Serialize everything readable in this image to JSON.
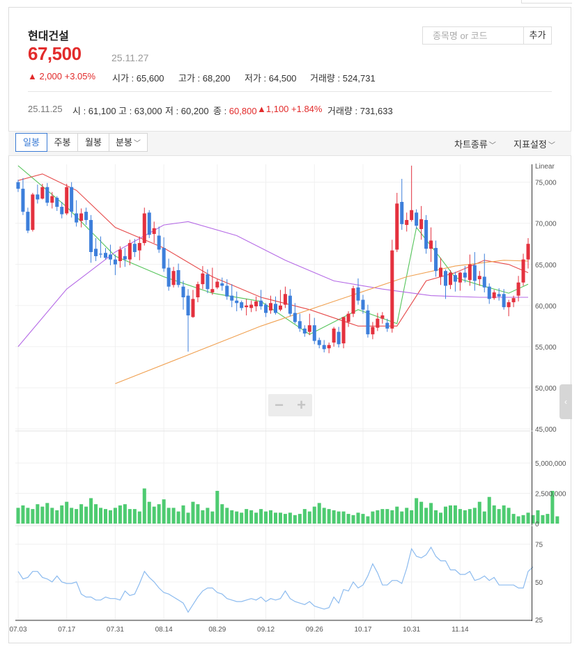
{
  "stock": {
    "name": "현대건설",
    "price": "67,500",
    "date": "25.11.27",
    "change": "▲ 2,000 +3.05%",
    "stats": [
      {
        "label": "시가 : ",
        "value": "65,600"
      },
      {
        "label": "고가 : ",
        "value": "68,200"
      },
      {
        "label": "저가 : ",
        "value": "64,500"
      },
      {
        "label": "거래량 : ",
        "value": "524,731"
      }
    ]
  },
  "search": {
    "placeholder": "종목명 or 코드",
    "add_label": "추가"
  },
  "prev": {
    "date": "25.11.25",
    "open": "시 : 61,100",
    "high": "고 : 63,000",
    "low": "저 : 60,200",
    "close_label": "종 : ",
    "close_value": "60,800",
    "change": "▲1,100 +1.84%",
    "volume": "거래량 : 731,633"
  },
  "periods": [
    "일봉",
    "주봉",
    "월봉",
    "분봉"
  ],
  "chart_type_label": "차트종류",
  "indicator_label": "지표설정",
  "colors": {
    "up": "#e4313e",
    "down": "#3d7fdb",
    "volume": "#4ecb71",
    "ma5": "#55c45a",
    "ma20": "#e64a4a",
    "ma60": "#b56ae6",
    "ma120": "#f0a050",
    "rsi": "#8cbbef"
  },
  "chart_data": [
    {
      "type": "candlestick",
      "scale_label": "Linear",
      "ylim": [
        45000,
        77000
      ],
      "yticks": [
        "75,000",
        "70,000",
        "65,000",
        "60,000",
        "55,000",
        "50,000",
        "45,000"
      ],
      "ytick_values": [
        75000,
        70000,
        65000,
        60000,
        55000,
        50000,
        45000
      ],
      "x_ticks": [
        "07.03",
        "07.17",
        "07.31",
        "08.14",
        "08.29",
        "09.12",
        "09.26",
        "10.17",
        "10.31",
        "11.14"
      ],
      "x_tick_index": [
        0,
        10,
        20,
        30,
        41,
        51,
        61,
        71,
        81,
        91
      ],
      "candles": [
        [
          75000,
          75300,
          73800,
          74200
        ],
        [
          74200,
          75500,
          71000,
          71400
        ],
        [
          71400,
          71900,
          68800,
          69100
        ],
        [
          69200,
          73700,
          69000,
          73500
        ],
        [
          73500,
          74700,
          72400,
          72900
        ],
        [
          73000,
          74800,
          72900,
          74400
        ],
        [
          74400,
          74900,
          72100,
          72500
        ],
        [
          72500,
          73800,
          71800,
          73300
        ],
        [
          73100,
          73300,
          71500,
          72000
        ],
        [
          72000,
          72600,
          70600,
          71100
        ],
        [
          71200,
          74800,
          71000,
          74400
        ],
        [
          74400,
          75000,
          70700,
          71400
        ],
        [
          71200,
          72800,
          69600,
          70100
        ],
        [
          70300,
          71800,
          69500,
          71200
        ],
        [
          71400,
          71900,
          69800,
          70400
        ],
        [
          70400,
          71000,
          65200,
          66500
        ],
        [
          66900,
          68200,
          65400,
          66000
        ],
        [
          66300,
          68400,
          65800,
          66200
        ],
        [
          66400,
          67000,
          65600,
          65800
        ],
        [
          66200,
          67400,
          64900,
          65600
        ],
        [
          65600,
          66200,
          63700,
          65000
        ],
        [
          65400,
          67200,
          64600,
          66800
        ],
        [
          66000,
          67000,
          64700,
          65600
        ],
        [
          65600,
          68000,
          64900,
          67600
        ],
        [
          67500,
          68100,
          65900,
          66500
        ],
        [
          66700,
          68400,
          65500,
          67600
        ],
        [
          67600,
          71900,
          67300,
          71200
        ],
        [
          71300,
          71600,
          68200,
          68600
        ],
        [
          68700,
          70200,
          67600,
          69400
        ],
        [
          68500,
          69600,
          66400,
          66800
        ],
        [
          67000,
          68300,
          64100,
          64500
        ],
        [
          64600,
          65700,
          61800,
          62300
        ],
        [
          62500,
          64700,
          62200,
          64200
        ],
        [
          64300,
          65100,
          62200,
          62500
        ],
        [
          62300,
          63000,
          59500,
          61000
        ],
        [
          61200,
          62000,
          54400,
          58800
        ],
        [
          58600,
          61900,
          58500,
          60800
        ],
        [
          61000,
          62900,
          60400,
          62600
        ],
        [
          62600,
          64800,
          62000,
          63900
        ],
        [
          63800,
          64400,
          61500,
          62000
        ],
        [
          61600,
          64600,
          61300,
          62000
        ],
        [
          62200,
          63200,
          62000,
          62900
        ],
        [
          62700,
          63400,
          61800,
          62400
        ],
        [
          62400,
          63200,
          60700,
          61100
        ],
        [
          61200,
          62600,
          59800,
          60600
        ],
        [
          60600,
          61700,
          59300,
          60300
        ],
        [
          60400,
          60600,
          59400,
          59700
        ],
        [
          59800,
          60800,
          58800,
          60000
        ],
        [
          59700,
          60600,
          59200,
          60100
        ],
        [
          59900,
          61100,
          59300,
          60500
        ],
        [
          60600,
          61900,
          59500,
          59900
        ],
        [
          60100,
          60300,
          58600,
          59100
        ],
        [
          59400,
          61200,
          59000,
          60300
        ],
        [
          60200,
          61100,
          58900,
          59100
        ],
        [
          59500,
          61900,
          59300,
          60000
        ],
        [
          60100,
          62300,
          59700,
          61400
        ],
        [
          61200,
          62000,
          58700,
          59000
        ],
        [
          59100,
          60300,
          57800,
          58000
        ],
        [
          58100,
          59000,
          56800,
          57200
        ],
        [
          57200,
          57600,
          56200,
          56600
        ],
        [
          56800,
          59000,
          56400,
          57600
        ],
        [
          57600,
          58500,
          55300,
          55700
        ],
        [
          55800,
          56100,
          54800,
          55200
        ],
        [
          55200,
          55800,
          54300,
          54700
        ],
        [
          54800,
          55500,
          54200,
          55200
        ],
        [
          55500,
          57400,
          55000,
          57200
        ],
        [
          56800,
          57400,
          54900,
          55300
        ],
        [
          55400,
          58000,
          54800,
          58600
        ],
        [
          58000,
          59300,
          57400,
          59000
        ],
        [
          59000,
          62400,
          58600,
          62100
        ],
        [
          62200,
          63300,
          60100,
          60600
        ],
        [
          60700,
          61300,
          59000,
          59500
        ],
        [
          59400,
          60100,
          56100,
          56500
        ],
        [
          56500,
          58000,
          55900,
          57400
        ],
        [
          57300,
          59100,
          56900,
          58400
        ],
        [
          58400,
          59200,
          57800,
          58800
        ],
        [
          57900,
          58400,
          56800,
          57200
        ],
        [
          57200,
          68000,
          56700,
          66700
        ],
        [
          66800,
          73700,
          66500,
          72400
        ],
        [
          72600,
          75400,
          69200,
          69900
        ],
        [
          69800,
          71300,
          69000,
          70400
        ],
        [
          70400,
          77000,
          70200,
          71600
        ],
        [
          71300,
          71700,
          69300,
          69700
        ],
        [
          69300,
          72100,
          68000,
          70500
        ],
        [
          70400,
          71000,
          66300,
          66900
        ],
        [
          66900,
          69500,
          65300,
          67900
        ],
        [
          67000,
          67900,
          63500,
          64200
        ],
        [
          63500,
          65800,
          62500,
          64600
        ],
        [
          64200,
          64400,
          60800,
          62400
        ],
        [
          62500,
          64300,
          62000,
          64000
        ],
        [
          63700,
          64100,
          61700,
          62900
        ],
        [
          62800,
          64100,
          61800,
          64000
        ],
        [
          64000,
          64800,
          62800,
          63400
        ],
        [
          63100,
          66200,
          62400,
          65000
        ],
        [
          64900,
          66500,
          61800,
          63000
        ],
        [
          63200,
          64200,
          62400,
          63600
        ],
        [
          63500,
          66300,
          61600,
          62200
        ],
        [
          62300,
          62700,
          60200,
          60800
        ],
        [
          60900,
          61900,
          60700,
          61600
        ],
        [
          61400,
          62100,
          60600,
          61100
        ],
        [
          61400,
          62000,
          59500,
          59800
        ],
        [
          59800,
          60700,
          58700,
          60400
        ],
        [
          60400,
          61200,
          59800,
          60900
        ],
        [
          61200,
          63600,
          60500,
          62800
        ],
        [
          62800,
          66300,
          62400,
          65600
        ],
        [
          65600,
          68200,
          64500,
          67500
        ]
      ],
      "moving_averages": [
        {
          "name": "MA5",
          "color": "#55c45a",
          "values": [
            [
              0,
              77000
            ],
            [
              10,
              72000
            ],
            [
              20,
              66000
            ],
            [
              30,
              63500
            ],
            [
              40,
              61500
            ],
            [
              50,
              60500
            ],
            [
              60,
              56500
            ],
            [
              70,
              59500
            ],
            [
              78,
              57800
            ],
            [
              82,
              69500
            ],
            [
              86,
              66500
            ],
            [
              90,
              63400
            ],
            [
              95,
              62500
            ],
            [
              101,
              61500
            ],
            [
              105,
              62600
            ]
          ]
        },
        {
          "name": "MA20",
          "color": "#e64a4a",
          "values": [
            [
              0,
              75200
            ],
            [
              5,
              76000
            ],
            [
              12,
              74000
            ],
            [
              20,
              69500
            ],
            [
              30,
              67000
            ],
            [
              40,
              63500
            ],
            [
              50,
              61000
            ],
            [
              60,
              59500
            ],
            [
              70,
              57500
            ],
            [
              78,
              57500
            ],
            [
              84,
              63000
            ],
            [
              90,
              64000
            ],
            [
              96,
              65500
            ],
            [
              101,
              65000
            ],
            [
              105,
              64000
            ]
          ]
        },
        {
          "name": "MA60",
          "color": "#b56ae6",
          "values": [
            [
              0,
              55000
            ],
            [
              10,
              62000
            ],
            [
              20,
              66500
            ],
            [
              30,
              69800
            ],
            [
              35,
              70200
            ],
            [
              45,
              68500
            ],
            [
              55,
              65500
            ],
            [
              65,
              63000
            ],
            [
              75,
              62000
            ],
            [
              85,
              61200
            ],
            [
              95,
              61000
            ],
            [
              105,
              61000
            ]
          ]
        },
        {
          "name": "MA120",
          "color": "#f0a050",
          "values": [
            [
              20,
              50500
            ],
            [
              35,
              54000
            ],
            [
              50,
              57500
            ],
            [
              65,
              60500
            ],
            [
              80,
              63500
            ],
            [
              90,
              64800
            ],
            [
              100,
              65500
            ],
            [
              105,
              65400
            ]
          ]
        }
      ]
    },
    {
      "type": "bar",
      "name": "거래량",
      "ylim": [
        0,
        5000000
      ],
      "yticks": [
        "5,000,000",
        "2,500,000",
        "0"
      ],
      "ytick_values": [
        5000000,
        2500000,
        0
      ],
      "values": [
        1300000,
        1500000,
        1300000,
        1200000,
        1600000,
        1400000,
        1700000,
        1300000,
        1100000,
        1500000,
        1800000,
        1300000,
        1200000,
        1600000,
        1400000,
        2100000,
        1600000,
        1300000,
        1200000,
        1100000,
        1300000,
        1500000,
        1600000,
        1200000,
        1200000,
        1000000,
        2900000,
        1800000,
        1400000,
        1600000,
        2000000,
        1300000,
        1300000,
        1000000,
        1500000,
        900000,
        1800000,
        1600000,
        1100000,
        1300000,
        1000000,
        2700000,
        1600000,
        1300000,
        1100000,
        1000000,
        900000,
        1200000,
        1100000,
        900000,
        1200000,
        1000000,
        1100000,
        900000,
        900000,
        800000,
        900000,
        700000,
        800000,
        1200000,
        1000000,
        1400000,
        1700000,
        1300000,
        1200000,
        1100000,
        1000000,
        1000000,
        800000,
        700000,
        900000,
        800000,
        600000,
        1000000,
        1100000,
        1200000,
        1200000,
        1100000,
        1400000,
        1000000,
        1300000,
        1100000,
        2100000,
        1800000,
        1300000,
        1700000,
        1100000,
        900000,
        1400000,
        1500000,
        1500000,
        1200000,
        1100000,
        1200000,
        1300000,
        1800000,
        1000000,
        2200000,
        1500000,
        1200000,
        1500000,
        1300000,
        800000,
        600000,
        700000,
        900000,
        700000,
        1100000,
        700000,
        800000,
        2700000,
        600000
      ]
    },
    {
      "type": "line",
      "name": "RSI",
      "ylim": [
        25,
        85
      ],
      "yticks": [
        "75",
        "50",
        "25"
      ],
      "ytick_values": [
        75,
        50,
        25
      ],
      "values": [
        57,
        52,
        53,
        57,
        57,
        53,
        52,
        50,
        54,
        50,
        49,
        49,
        50,
        42,
        40,
        40,
        38,
        38,
        40,
        39,
        39,
        38,
        44,
        41,
        42,
        49,
        57,
        53,
        50,
        46,
        43,
        42,
        40,
        38,
        36,
        30,
        35,
        40,
        44,
        46,
        46,
        43,
        42,
        39,
        38,
        37,
        37,
        38,
        39,
        38,
        40,
        37,
        39,
        38,
        39,
        44,
        39,
        37,
        36,
        35,
        37,
        34,
        33,
        32,
        33,
        40,
        36,
        45,
        44,
        50,
        46,
        48,
        54,
        62,
        56,
        48,
        48,
        51,
        51,
        49,
        59,
        72,
        67,
        66,
        68,
        73,
        67,
        64,
        64,
        58,
        58,
        55,
        55,
        57,
        51,
        52,
        54,
        51,
        53,
        48,
        48,
        48,
        48,
        46,
        46,
        57,
        60
      ]
    }
  ]
}
